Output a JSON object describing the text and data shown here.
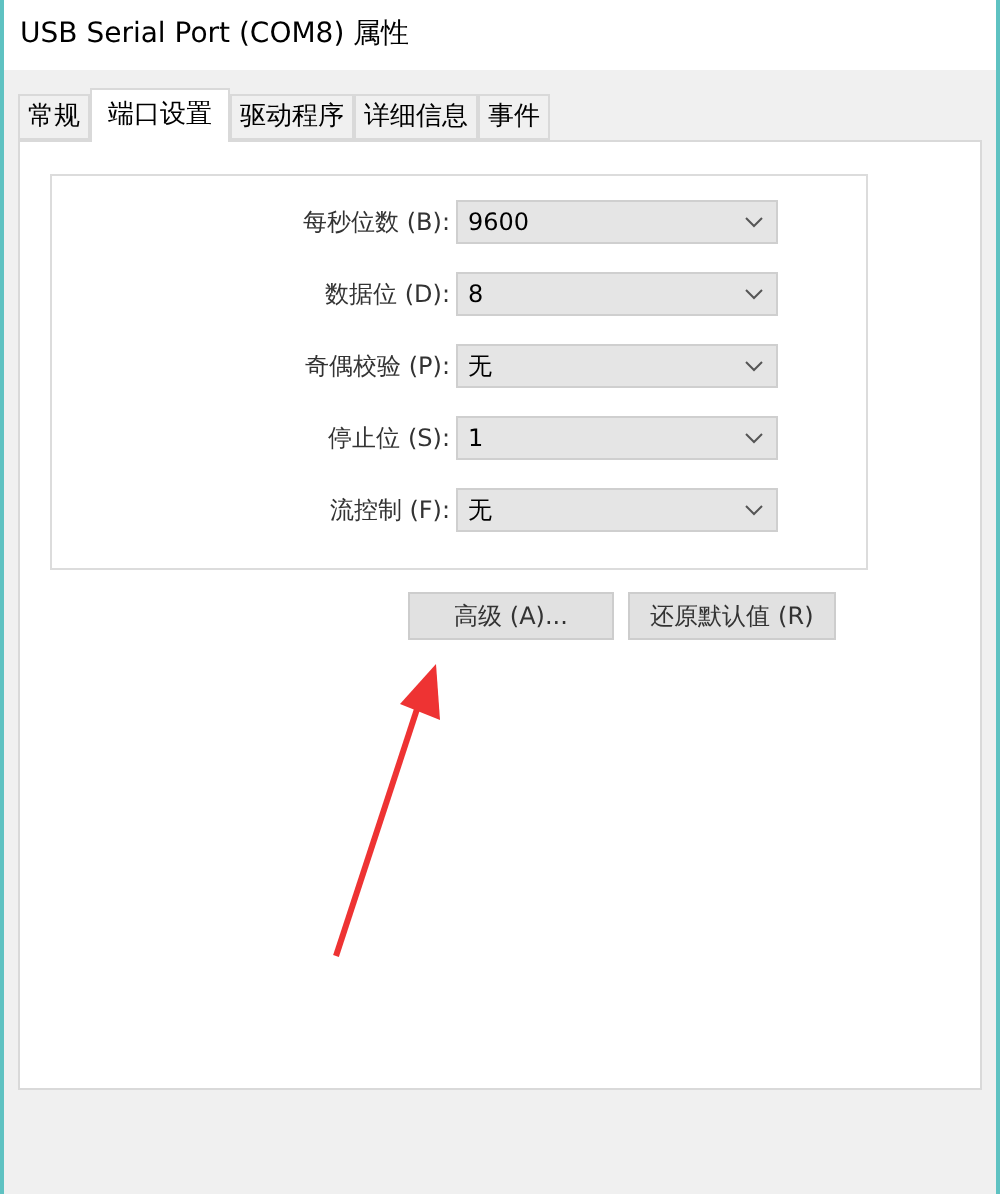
{
  "window": {
    "title": "USB Serial Port (COM8) 属性"
  },
  "tabs": [
    {
      "label": "常规",
      "selected": false
    },
    {
      "label": "端口设置",
      "selected": true
    },
    {
      "label": "驱动程序",
      "selected": false
    },
    {
      "label": "详细信息",
      "selected": false
    },
    {
      "label": "事件",
      "selected": false
    }
  ],
  "settings": [
    {
      "label": "每秒位数 (B):",
      "value": "9600"
    },
    {
      "label": "数据位 (D):",
      "value": "8"
    },
    {
      "label": "奇偶校验 (P):",
      "value": "无"
    },
    {
      "label": "停止位 (S):",
      "value": "1"
    },
    {
      "label": "流控制 (F):",
      "value": "无"
    }
  ],
  "buttons": [
    "高级 (A)...",
    "还原默认值 (R)"
  ],
  "annotation": {
    "kind": "arrow"
  }
}
